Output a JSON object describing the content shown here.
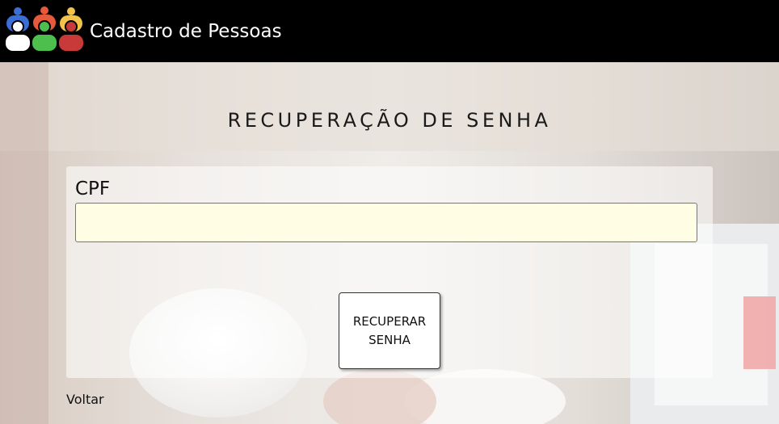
{
  "header": {
    "title": "Cadastro de Pessoas",
    "logo_icon": "people-group-icon",
    "colors": [
      "#3a6fd8",
      "#e55a3a",
      "#f2c24a",
      "#ffffff",
      "#4cbf4c",
      "#c83a3a"
    ]
  },
  "main": {
    "heading": "RECUPERAÇÃO DE SENHA",
    "cpf_label": "CPF",
    "cpf_value": "",
    "cpf_placeholder": "",
    "recover_button": "RECUPERAR SENHA",
    "back_link": "Voltar"
  }
}
